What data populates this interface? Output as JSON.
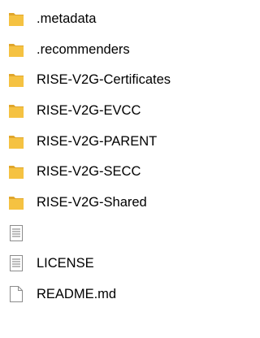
{
  "explorer": {
    "items": [
      {
        "name": ".metadata",
        "icon": "folder-icon",
        "type": "folder"
      },
      {
        "name": ".recommenders",
        "icon": "folder-icon",
        "type": "folder"
      },
      {
        "name": "RISE-V2G-Certificates",
        "icon": "folder-icon",
        "type": "folder"
      },
      {
        "name": "RISE-V2G-EVCC",
        "icon": "folder-icon",
        "type": "folder"
      },
      {
        "name": "RISE-V2G-PARENT",
        "icon": "folder-icon",
        "type": "folder"
      },
      {
        "name": "RISE-V2G-SECC",
        "icon": "folder-icon",
        "type": "folder"
      },
      {
        "name": "RISE-V2G-Shared",
        "icon": "folder-icon",
        "type": "folder"
      },
      {
        "name": "",
        "icon": "text-file-icon",
        "type": "file"
      },
      {
        "name": "LICENSE",
        "icon": "text-file-icon",
        "type": "file"
      },
      {
        "name": "README.md",
        "icon": "blank-file-icon",
        "type": "file"
      }
    ]
  },
  "colors": {
    "folder_body": "#F5C242",
    "folder_back": "#E0A62B",
    "file_border": "#8C8C8C",
    "file_lines": "#7A7A7A"
  }
}
